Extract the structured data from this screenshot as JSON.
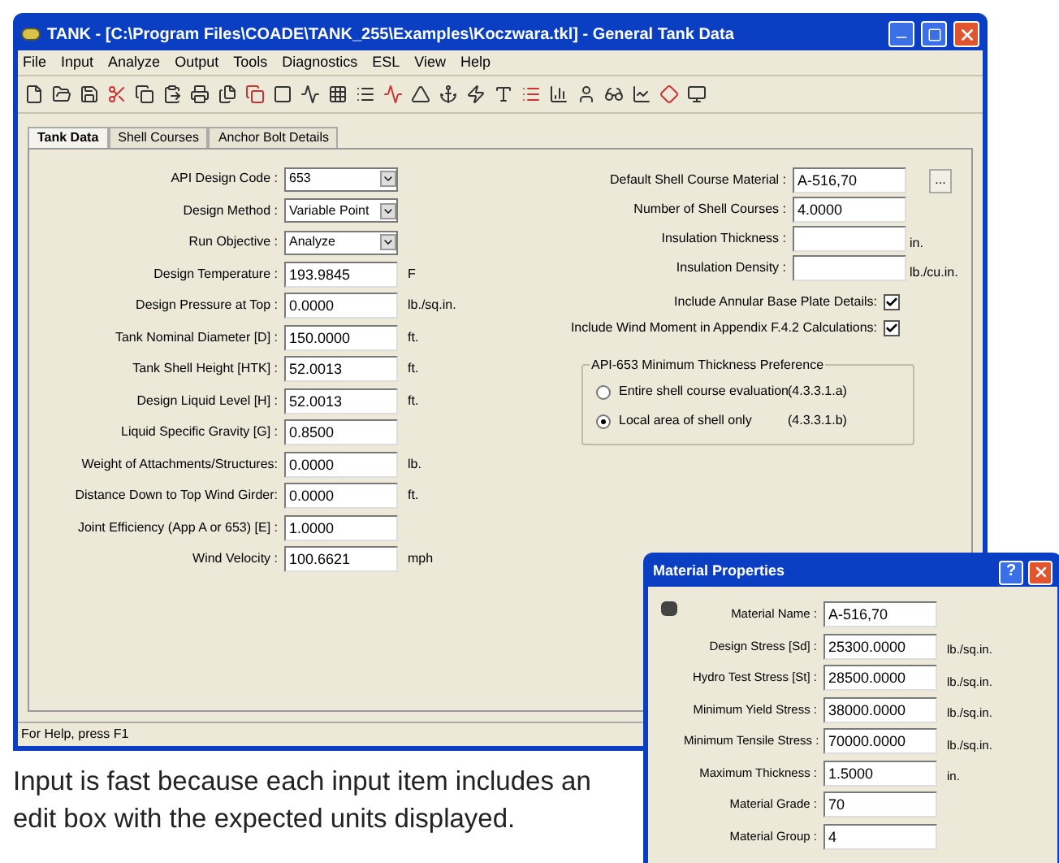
{
  "window": {
    "title": "TANK - [C:\\Program Files\\COADE\\TANK_255\\Examples\\Koczwara.tkl] - General Tank Data"
  },
  "menu": [
    "File",
    "Input",
    "Analyze",
    "Output",
    "Tools",
    "Diagnostics",
    "ESL",
    "View",
    "Help"
  ],
  "tabs": [
    {
      "label": "Tank Data",
      "selected": true
    },
    {
      "label": "Shell Courses",
      "selected": false
    },
    {
      "label": "Anchor Bolt Details",
      "selected": false
    }
  ],
  "left_fields": [
    {
      "kind": "dropdown",
      "label": "API Design Code :",
      "value": "653"
    },
    {
      "kind": "dropdown",
      "label": "Design Method :",
      "value": "Variable Point"
    },
    {
      "kind": "dropdown",
      "label": "Run Objective :",
      "value": "Analyze"
    },
    {
      "kind": "text",
      "label": "Design Temperature :",
      "value": "193.9845",
      "unit": "F"
    },
    {
      "kind": "text",
      "label": "Design Pressure at Top :",
      "value": "0.0000",
      "unit": "lb./sq.in."
    },
    {
      "kind": "text",
      "label": "Tank Nominal Diameter [D] :",
      "value": "150.0000",
      "unit": "ft."
    },
    {
      "kind": "text",
      "label": "Tank Shell Height [HTK] :",
      "value": "52.0013",
      "unit": "ft."
    },
    {
      "kind": "text",
      "label": "Design Liquid Level [H] :",
      "value": "52.0013",
      "unit": "ft."
    },
    {
      "kind": "text",
      "label": "Liquid Specific Gravity [G] :",
      "value": "0.8500"
    },
    {
      "kind": "text",
      "label": "Weight of Attachments/Structures:",
      "value": "0.0000",
      "unit": "lb."
    },
    {
      "kind": "text",
      "label": "Distance Down to Top Wind Girder:",
      "value": "0.0000",
      "unit": "ft."
    },
    {
      "kind": "text",
      "label": "Joint Efficiency (App A or 653) [E] :",
      "value": "1.0000"
    },
    {
      "kind": "text",
      "label": "Wind Velocity :",
      "value": "100.6621",
      "unit": "mph"
    }
  ],
  "right_fields": [
    {
      "label": "Default Shell Course Material :",
      "value": "A-516,70",
      "browse": "..."
    },
    {
      "label": "Number of Shell Courses :",
      "value": "4.0000"
    },
    {
      "label": "Insulation Thickness :",
      "unit": "in."
    },
    {
      "label": "Insulation Density :",
      "unit": "lb./cu.in."
    }
  ],
  "checkboxes": [
    {
      "label": "Include Annular Base Plate Details:",
      "checked": true
    },
    {
      "label": "Include Wind Moment in Appendix F.4.2 Calculations:",
      "checked": true
    }
  ],
  "thickness_group": {
    "title": "API-653 Minimum Thickness Preference",
    "options": [
      {
        "label": "Entire shell course evaluation",
        "ref": "(4.3.3.1.a)",
        "selected": false
      },
      {
        "label": "Local area of shell only",
        "ref": "(4.3.3.1.b)",
        "selected": true
      }
    ]
  },
  "status_bar": "For Help, press F1",
  "dialog": {
    "title": "Material Properties",
    "help_button": "?",
    "fields": [
      {
        "label": "Material Name :",
        "value": "A-516,70"
      },
      {
        "label": "Design Stress [Sd] :",
        "value": "25300.0000",
        "unit": "lb./sq.in."
      },
      {
        "label": "Hydro Test Stress [St] :",
        "value": "28500.0000",
        "unit": "lb./sq.in."
      },
      {
        "label": "Minimum Yield Stress :",
        "value": "38000.0000",
        "unit": "lb./sq.in."
      },
      {
        "label": "Minimum Tensile Stress :",
        "value": "70000.0000",
        "unit": "lb./sq.in."
      },
      {
        "label": "Maximum Thickness :",
        "value": "1.5000",
        "unit": "in."
      },
      {
        "label": "Material Grade :",
        "value": "70"
      },
      {
        "label": "Material Group :",
        "value": "4"
      }
    ]
  },
  "caption": "Input is fast because each input item includes an edit box with the expected units displayed."
}
